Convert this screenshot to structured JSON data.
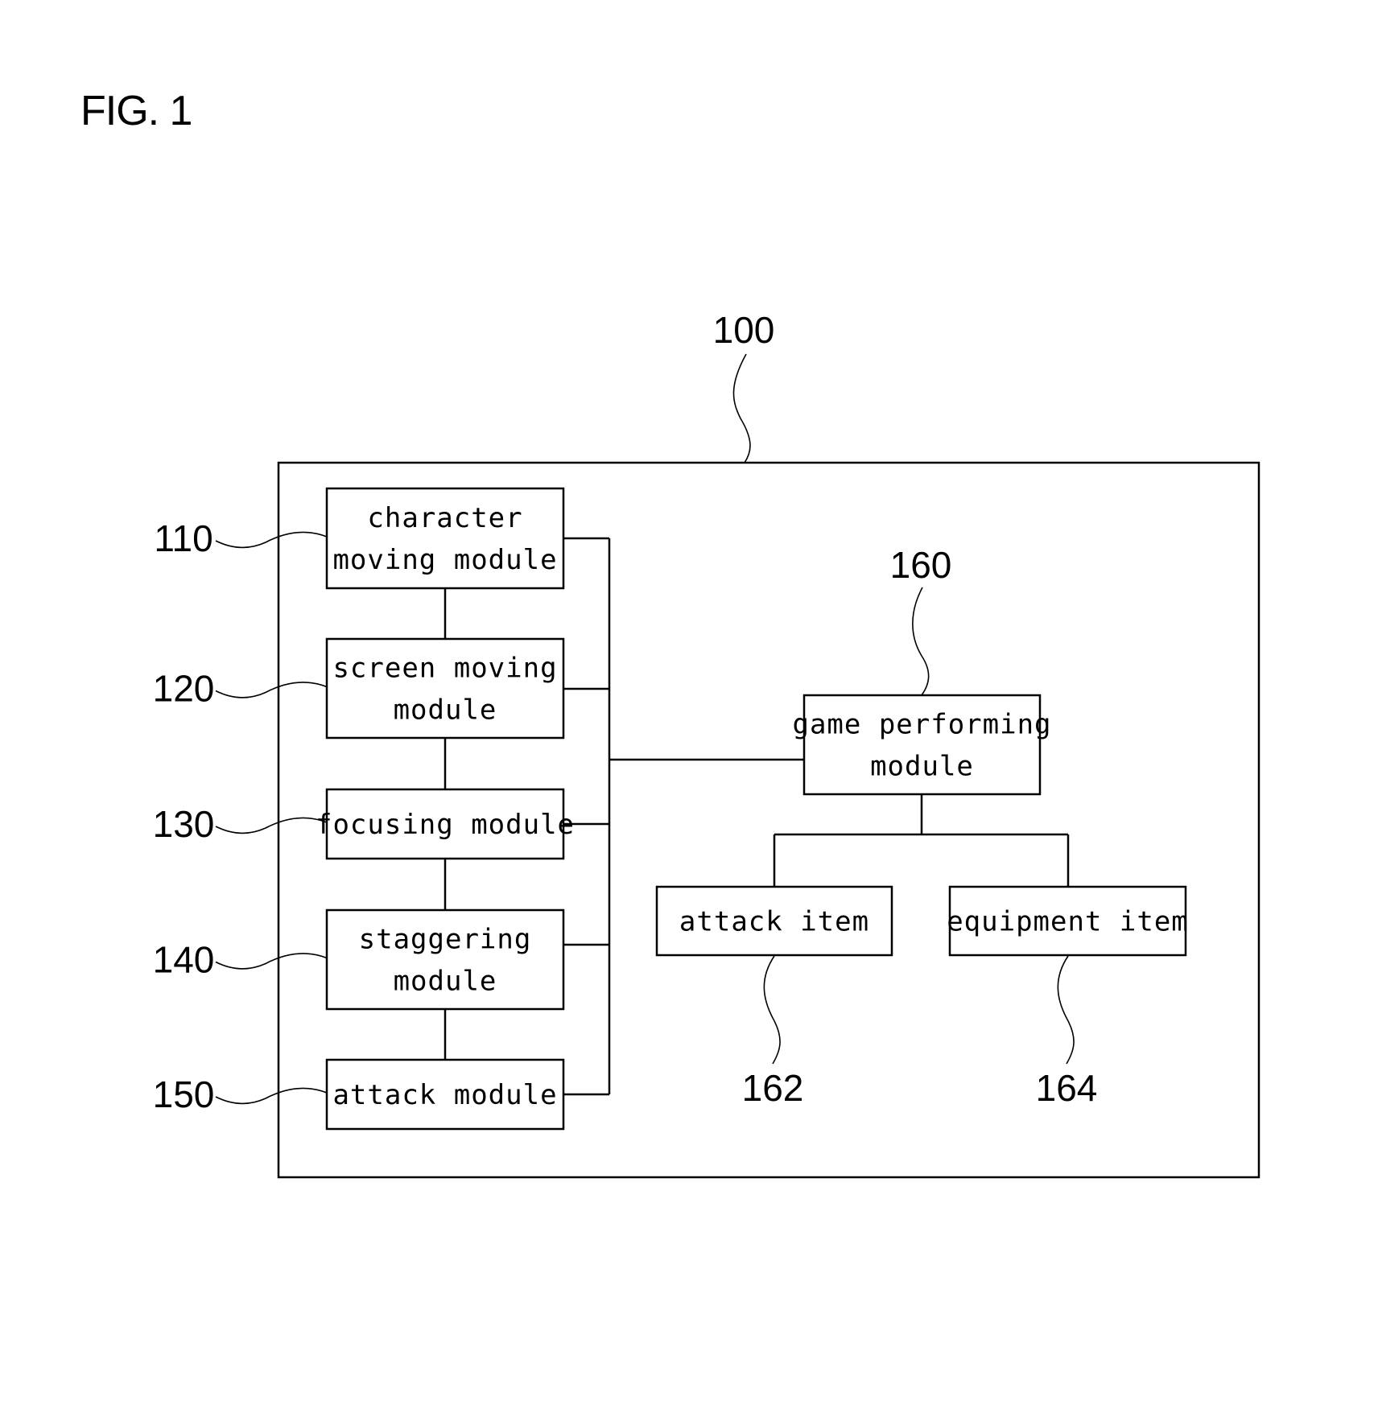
{
  "figure": {
    "title": "FIG. 1"
  },
  "system": {
    "ref": "100"
  },
  "modules": [
    {
      "ref": "110",
      "lines": [
        "character",
        "moving module"
      ]
    },
    {
      "ref": "120",
      "lines": [
        "screen moving",
        "module"
      ]
    },
    {
      "ref": "130",
      "lines": [
        "focusing module"
      ]
    },
    {
      "ref": "140",
      "lines": [
        "staggering",
        "module"
      ]
    },
    {
      "ref": "150",
      "lines": [
        "attack module"
      ]
    }
  ],
  "game_module": {
    "ref": "160",
    "lines": [
      "game performing",
      "module"
    ]
  },
  "items": [
    {
      "ref": "162",
      "lines": [
        "attack item"
      ]
    },
    {
      "ref": "164",
      "lines": [
        "equipment item"
      ]
    }
  ]
}
